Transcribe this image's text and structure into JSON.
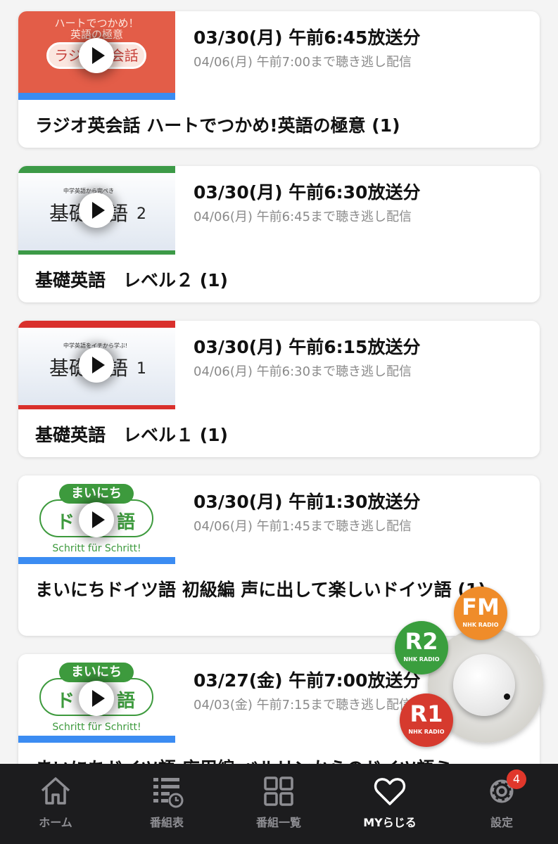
{
  "episodes": [
    {
      "thumb_lines": [
        "ハートでつかめ！",
        "英語の極意",
        "ラジオ英会話"
      ],
      "air_date": "03/30(月) 午前6:45放送分",
      "catchup": "04/06(月) 午前7:00まで聴き逃し配信",
      "title": "ラジオ英会話 ハートでつかめ!英語の極意 (1)",
      "accent_color": "#3b8cf2"
    },
    {
      "thumb_lines": [
        "中学英語から完ぺき",
        "基礎英語",
        "2"
      ],
      "air_date": "03/30(月) 午前6:30放送分",
      "catchup": "04/06(月) 午前6:45まで聴き逃し配信",
      "title": "基礎英語　レベル２ (1)",
      "accent_color": "#3c9a47"
    },
    {
      "thumb_lines": [
        "中学英語をイチから学ぶ!",
        "基礎英語",
        "1"
      ],
      "air_date": "03/30(月) 午前6:15放送分",
      "catchup": "04/06(月) 午前6:30まで聴き逃し配信",
      "title": "基礎英語　レベル１ (1)",
      "accent_color": "#d9302c"
    },
    {
      "thumb_lines": [
        "まいにち",
        "ドイツ語",
        "Schritt für Schritt!"
      ],
      "air_date": "03/30(月) 午前1:30放送分",
      "catchup": "04/06(月) 午前1:45まで聴き逃し配信",
      "title": "まいにちドイツ語 初級編 声に出して楽しいドイツ語 (1)",
      "accent_color": "#3b8cf2"
    },
    {
      "thumb_lines": [
        "まいにち",
        "ドイツ語",
        "Schritt für Schritt!"
      ],
      "air_date": "03/27(金) 午前7:00放送分",
      "catchup": "04/03(金) 午前7:15まで聴き逃し配信",
      "title": "まいにちドイツ語 応用編 ベルリンからのドイツ語ミ",
      "accent_color": "#3b8cf2"
    }
  ],
  "radio_dial": {
    "stations": [
      {
        "code": "FM",
        "sub": "NHK RADIO",
        "color": "#ef8c2a"
      },
      {
        "code": "R2",
        "sub": "NHK RADIO",
        "color": "#3a9e3e"
      },
      {
        "code": "R1",
        "sub": "NHK RADIO",
        "color": "#d63a2e"
      }
    ]
  },
  "tabbar": {
    "tabs": [
      {
        "label": "ホーム",
        "icon": "home-icon"
      },
      {
        "label": "番組表",
        "icon": "schedule-icon"
      },
      {
        "label": "番組一覧",
        "icon": "grid-icon"
      },
      {
        "label": "MYらじる",
        "icon": "heart-icon",
        "active": true
      },
      {
        "label": "設定",
        "icon": "gear-icon",
        "badge": "4"
      }
    ]
  }
}
